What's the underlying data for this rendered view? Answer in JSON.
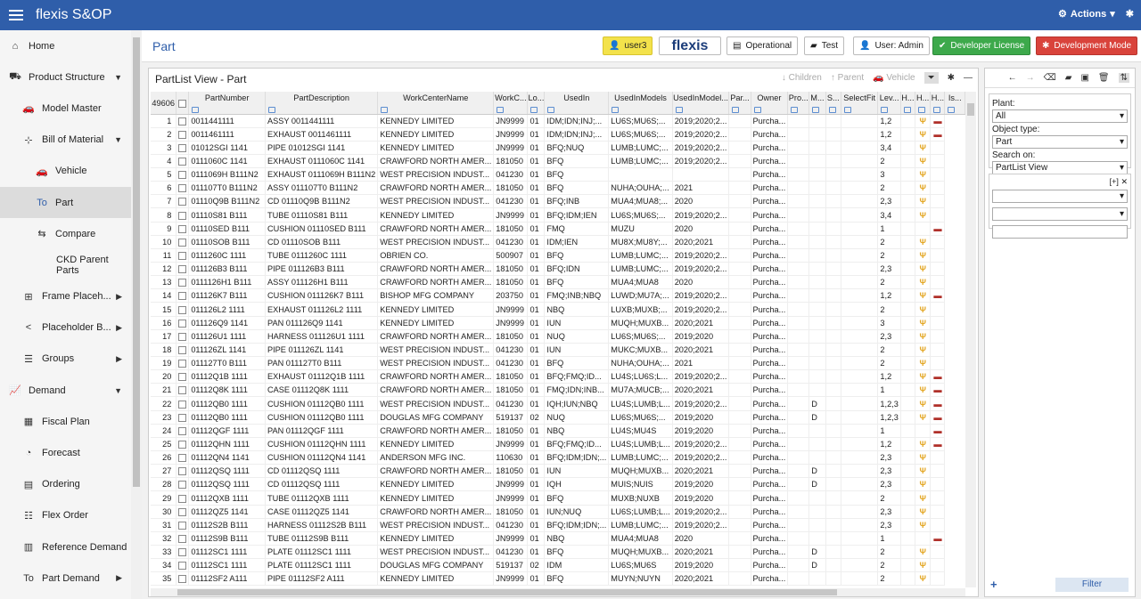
{
  "app": {
    "title": "flexis S&OP",
    "actions_label": "Actions"
  },
  "sidebar": {
    "items": [
      {
        "label": "Home",
        "icon": "home-icon",
        "level": 0,
        "glyph": "⌂"
      },
      {
        "label": "Product Structure",
        "icon": "truck-icon",
        "level": 0,
        "glyph": "⛟",
        "arrow": "▼"
      },
      {
        "label": "Model Master",
        "icon": "car-icon",
        "level": 1,
        "glyph": "🚗"
      },
      {
        "label": "Bill of Material",
        "icon": "tree-icon",
        "level": 1,
        "glyph": "⊹",
        "arrow": "▼"
      },
      {
        "label": "Vehicle",
        "icon": "car-icon",
        "level": 2,
        "glyph": "🚗"
      },
      {
        "label": "Part",
        "icon": "part-icon",
        "level": 2,
        "glyph": "To",
        "active": true
      },
      {
        "label": "Compare",
        "icon": "compare-icon",
        "level": 2,
        "glyph": "⇆"
      },
      {
        "label": "CKD Parent Parts",
        "icon": "",
        "level": 3,
        "glyph": ""
      },
      {
        "label": "Frame Placeh...",
        "icon": "frame-icon",
        "level": 1,
        "glyph": "⊞",
        "arrow": "▶"
      },
      {
        "label": "Placeholder B...",
        "icon": "share-icon",
        "level": 1,
        "glyph": "<",
        "arrow": "▶"
      },
      {
        "label": "Groups",
        "icon": "stack-icon",
        "level": 1,
        "glyph": "☰",
        "arrow": "▶"
      },
      {
        "label": "Demand",
        "icon": "chart-icon",
        "level": 0,
        "glyph": "📈",
        "arrow": "▼"
      },
      {
        "label": "Fiscal Plan",
        "icon": "calendar-icon",
        "level": 1,
        "glyph": "▦"
      },
      {
        "label": "Forecast",
        "icon": "forecast-icon",
        "level": 1,
        "glyph": "◔"
      },
      {
        "label": "Ordering",
        "icon": "clipboard-icon",
        "level": 1,
        "glyph": "▤"
      },
      {
        "label": "Flex Order",
        "icon": "list-icon",
        "level": 1,
        "glyph": "☷"
      },
      {
        "label": "Reference Demand",
        "icon": "document-icon",
        "level": 1,
        "glyph": "▥"
      },
      {
        "label": "Part Demand",
        "icon": "part-icon",
        "level": 1,
        "glyph": "To",
        "arrow": "▶"
      }
    ]
  },
  "header": {
    "page_title": "Part",
    "user_chip": "user3",
    "logo": "flexis",
    "env": "Operational",
    "folder": "Test",
    "user_admin": "User: Admin",
    "license": "Developer License",
    "mode": "Development Mode"
  },
  "panel": {
    "title": "PartList View - Part",
    "tools": {
      "children": "Children",
      "parent": "Parent",
      "vehicle": "Vehicle"
    }
  },
  "grid": {
    "count": "49606",
    "columns": [
      "PartNumber",
      "PartDescription",
      "WorkCenterName",
      "WorkC...",
      "Lo...",
      "UsedIn",
      "UsedInModels",
      "UsedInModel...",
      "Par...",
      "Owner",
      "Pro...",
      "M...",
      "S...",
      "SelectFit",
      "Lev...",
      "H...",
      "H...",
      "H...",
      "Is..."
    ],
    "rows": [
      [
        "1",
        "0011441111",
        "ASSY 0011441111",
        "KENNEDY LIMITED",
        "JN9999",
        "01",
        "IDM;IDN;INJ;...",
        "LU6S;MU6S;...",
        "2019;2020;2...",
        "",
        "Purcha...",
        "",
        "",
        "",
        "",
        "1,2",
        "",
        "T",
        "C"
      ],
      [
        "2",
        "0011461111",
        "EXHAUST 0011461111",
        "KENNEDY LIMITED",
        "JN9999",
        "01",
        "IDM;IDN;INJ;...",
        "LU6S;MU6S;...",
        "2019;2020;2...",
        "",
        "Purcha...",
        "",
        "",
        "",
        "",
        "1,2",
        "",
        "T",
        "C"
      ],
      [
        "3",
        "01012SGI 1141",
        "PIPE 01012SGI 1141",
        "KENNEDY LIMITED",
        "JN9999",
        "01",
        "BFQ;NUQ",
        "LUMB;LUMC;...",
        "2019;2020;2...",
        "",
        "Purcha...",
        "",
        "",
        "",
        "",
        "3,4",
        "",
        "T",
        ""
      ],
      [
        "4",
        "0111060C 1141",
        "EXHAUST 0111060C 1141",
        "CRAWFORD NORTH AMER...",
        "181050",
        "01",
        "BFQ",
        "LUMB;LUMC;...",
        "2019;2020;2...",
        "",
        "Purcha...",
        "",
        "",
        "",
        "",
        "2",
        "",
        "T",
        ""
      ],
      [
        "5",
        "0111069H B111N2",
        "EXHAUST 0111069H B111N2",
        "WEST PRECISION INDUST...",
        "041230",
        "01",
        "BFQ",
        "",
        "",
        "",
        "Purcha...",
        "",
        "",
        "",
        "",
        "3",
        "",
        "T",
        ""
      ],
      [
        "6",
        "011107T0 B111N2",
        "ASSY 011107T0 B111N2",
        "CRAWFORD NORTH AMER...",
        "181050",
        "01",
        "BFQ",
        "NUHA;OUHA;...",
        "2021",
        "",
        "Purcha...",
        "",
        "",
        "",
        "",
        "2",
        "",
        "T",
        ""
      ],
      [
        "7",
        "01110Q9B B111N2",
        "CD 01110Q9B B111N2",
        "WEST PRECISION INDUST...",
        "041230",
        "01",
        "BFQ;INB",
        "MUA4;MUA8;...",
        "2020",
        "",
        "Purcha...",
        "",
        "",
        "",
        "",
        "2,3",
        "",
        "T",
        ""
      ],
      [
        "8",
        "01110S81 B111",
        "TUBE 01110S81 B111",
        "KENNEDY LIMITED",
        "JN9999",
        "01",
        "BFQ;IDM;IEN",
        "LU6S;MU6S;...",
        "2019;2020;2...",
        "",
        "Purcha...",
        "",
        "",
        "",
        "",
        "3,4",
        "",
        "T",
        ""
      ],
      [
        "9",
        "01110SED B111",
        "CUSHION 01110SED B111",
        "CRAWFORD NORTH AMER...",
        "181050",
        "01",
        "FMQ",
        "MUZU",
        "2020",
        "",
        "Purcha...",
        "",
        "",
        "",
        "",
        "1",
        "",
        "",
        "C"
      ],
      [
        "10",
        "01110SOB B111",
        "CD 01110SOB B111",
        "WEST PRECISION INDUST...",
        "041230",
        "01",
        "IDM;IEN",
        "MU8X;MU8Y;...",
        "2020;2021",
        "",
        "Purcha...",
        "",
        "",
        "",
        "",
        "2",
        "",
        "T",
        ""
      ],
      [
        "11",
        "0111260C 1111",
        "TUBE 0111260C 1111",
        "OBRIEN CO.",
        "500907",
        "01",
        "BFQ",
        "LUMB;LUMC;...",
        "2019;2020;2...",
        "",
        "Purcha...",
        "",
        "",
        "",
        "",
        "2",
        "",
        "T",
        ""
      ],
      [
        "12",
        "011126B3 B111",
        "PIPE 011126B3 B111",
        "CRAWFORD NORTH AMER...",
        "181050",
        "01",
        "BFQ;IDN",
        "LUMB;LUMC;...",
        "2019;2020;2...",
        "",
        "Purcha...",
        "",
        "",
        "",
        "",
        "2,3",
        "",
        "T",
        ""
      ],
      [
        "13",
        "0111126H1 B111",
        "ASSY 011126H1 B111",
        "CRAWFORD NORTH AMER...",
        "181050",
        "01",
        "BFQ",
        "MUA4;MUA8",
        "2020",
        "",
        "Purcha...",
        "",
        "",
        "",
        "",
        "2",
        "",
        "T",
        ""
      ],
      [
        "14",
        "011126K7 B111",
        "CUSHION 011126K7 B111",
        "BISHOP MFG COMPANY",
        "203750",
        "01",
        "FMQ;INB;NBQ",
        "LUWD;MU7A;...",
        "2019;2020;2...",
        "",
        "Purcha...",
        "",
        "",
        "",
        "",
        "1,2",
        "",
        "T",
        "C"
      ],
      [
        "15",
        "011126L2 1111",
        "EXHAUST 011126L2 1111",
        "KENNEDY LIMITED",
        "JN9999",
        "01",
        "NBQ",
        "LUXB;MUXB;...",
        "2019;2020;2...",
        "",
        "Purcha...",
        "",
        "",
        "",
        "",
        "2",
        "",
        "T",
        ""
      ],
      [
        "16",
        "011126Q9 1141",
        "PAN 011126Q9 1141",
        "KENNEDY LIMITED",
        "JN9999",
        "01",
        "IUN",
        "MUQH;MUXB...",
        "2020;2021",
        "",
        "Purcha...",
        "",
        "",
        "",
        "",
        "3",
        "",
        "T",
        ""
      ],
      [
        "17",
        "011126U1 1111",
        "HARNESS 011126U1 1111",
        "CRAWFORD NORTH AMER...",
        "181050",
        "01",
        "NUQ",
        "LU6S;MU6S;...",
        "2019;2020",
        "",
        "Purcha...",
        "",
        "",
        "",
        "",
        "2,3",
        "",
        "T",
        ""
      ],
      [
        "18",
        "011126ZL 1141",
        "PIPE 011126ZL 1141",
        "WEST PRECISION INDUST...",
        "041230",
        "01",
        "IUN",
        "MUKC;MUXB...",
        "2020;2021",
        "",
        "Purcha...",
        "",
        "",
        "",
        "",
        "2",
        "",
        "T",
        ""
      ],
      [
        "19",
        "011127T0 B111",
        "PAN 011127T0 B111",
        "WEST PRECISION INDUST...",
        "041230",
        "01",
        "BFQ",
        "NUHA;OUHA;...",
        "2021",
        "",
        "Purcha...",
        "",
        "",
        "",
        "",
        "2",
        "",
        "T",
        ""
      ],
      [
        "20",
        "01112Q1B 1111",
        "EXHAUST 01112Q1B 1111",
        "CRAWFORD NORTH AMER...",
        "181050",
        "01",
        "BFQ;FMQ;ID...",
        "LU4S;LU6S;L...",
        "2019;2020;2...",
        "",
        "Purcha...",
        "",
        "",
        "",
        "",
        "1,2",
        "",
        "T",
        "C"
      ],
      [
        "21",
        "01112Q8K 1111",
        "CASE 01112Q8K 1111",
        "CRAWFORD NORTH AMER...",
        "181050",
        "01",
        "FMQ;IDN;INB...",
        "MU7A;MUCB;...",
        "2020;2021",
        "",
        "Purcha...",
        "",
        "",
        "",
        "",
        "1",
        "",
        "T",
        "C"
      ],
      [
        "22",
        "01112QB0 1111",
        "CUSHION 01112QB0 1111",
        "WEST PRECISION INDUST...",
        "041230",
        "01",
        "IQH;IUN;NBQ",
        "LU4S;LUMB;L...",
        "2019;2020;2...",
        "",
        "Purcha...",
        "",
        "D",
        "",
        "",
        "1,2,3",
        "",
        "T",
        "C"
      ],
      [
        "23",
        "01112QB0 1111",
        "CUSHION 01112QB0 1111",
        "DOUGLAS MFG COMPANY",
        "519137",
        "02",
        "NUQ",
        "LU6S;MU6S;...",
        "2019;2020",
        "",
        "Purcha...",
        "",
        "D",
        "",
        "",
        "1,2,3",
        "",
        "T",
        "C"
      ],
      [
        "24",
        "01112QGF 1111",
        "PAN 01112QGF 1111",
        "CRAWFORD NORTH AMER...",
        "181050",
        "01",
        "NBQ",
        "LU4S;MU4S",
        "2019;2020",
        "",
        "Purcha...",
        "",
        "",
        "",
        "",
        "1",
        "",
        "",
        "C"
      ],
      [
        "25",
        "01112QHN 1111",
        "CUSHION 01112QHN 1111",
        "KENNEDY LIMITED",
        "JN9999",
        "01",
        "BFQ;FMQ;ID...",
        "LU4S;LUMB;L...",
        "2019;2020;2...",
        "",
        "Purcha...",
        "",
        "",
        "",
        "",
        "1,2",
        "",
        "T",
        "C"
      ],
      [
        "26",
        "01112QN4 1141",
        "CUSHION 01112QN4 1141",
        "ANDERSON MFG INC.",
        "110630",
        "01",
        "BFQ;IDM;IDN;...",
        "LUMB;LUMC;...",
        "2019;2020;2...",
        "",
        "Purcha...",
        "",
        "",
        "",
        "",
        "2,3",
        "",
        "T",
        ""
      ],
      [
        "27",
        "01112QSQ 1111",
        "CD 01112QSQ 1111",
        "CRAWFORD NORTH AMER...",
        "181050",
        "01",
        "IUN",
        "MUQH;MUXB...",
        "2020;2021",
        "",
        "Purcha...",
        "",
        "D",
        "",
        "",
        "2,3",
        "",
        "T",
        ""
      ],
      [
        "28",
        "01112QSQ 1111",
        "CD 01112QSQ 1111",
        "KENNEDY LIMITED",
        "JN9999",
        "01",
        "IQH",
        "MUIS;NUIS",
        "2019;2020",
        "",
        "Purcha...",
        "",
        "D",
        "",
        "",
        "2,3",
        "",
        "T",
        ""
      ],
      [
        "29",
        "01112QXB 1111",
        "TUBE 01112QXB 1111",
        "KENNEDY LIMITED",
        "JN9999",
        "01",
        "BFQ",
        "MUXB;NUXB",
        "2019;2020",
        "",
        "Purcha...",
        "",
        "",
        "",
        "",
        "2",
        "",
        "T",
        ""
      ],
      [
        "30",
        "01112QZ5 1141",
        "CASE 01112QZ5 1141",
        "CRAWFORD NORTH AMER...",
        "181050",
        "01",
        "IUN;NUQ",
        "LU6S;LUMB;L...",
        "2019;2020;2...",
        "",
        "Purcha...",
        "",
        "",
        "",
        "",
        "2,3",
        "",
        "T",
        ""
      ],
      [
        "31",
        "01112S2B B111",
        "HARNESS 01112S2B B111",
        "WEST PRECISION INDUST...",
        "041230",
        "01",
        "BFQ;IDM;IDN;...",
        "LUMB;LUMC;...",
        "2019;2020;2...",
        "",
        "Purcha...",
        "",
        "",
        "",
        "",
        "2,3",
        "",
        "T",
        ""
      ],
      [
        "32",
        "01112S9B B111",
        "TUBE 01112S9B B111",
        "KENNEDY LIMITED",
        "JN9999",
        "01",
        "NBQ",
        "MUA4;MUA8",
        "2020",
        "",
        "Purcha...",
        "",
        "",
        "",
        "",
        "1",
        "",
        "",
        "C"
      ],
      [
        "33",
        "01112SC1 1111",
        "PLATE 01112SC1 1111",
        "WEST PRECISION INDUST...",
        "041230",
        "01",
        "BFQ",
        "MUQH;MUXB...",
        "2020;2021",
        "",
        "Purcha...",
        "",
        "D",
        "",
        "",
        "2",
        "",
        "T",
        ""
      ],
      [
        "34",
        "01112SC1 1111",
        "PLATE 01112SC1 1111",
        "DOUGLAS MFG COMPANY",
        "519137",
        "02",
        "IDM",
        "LU6S;MU6S",
        "2019;2020",
        "",
        "Purcha...",
        "",
        "D",
        "",
        "",
        "2",
        "",
        "T",
        ""
      ],
      [
        "35",
        "01112SF2 A111",
        "PIPE 01112SF2 A111",
        "KENNEDY LIMITED",
        "JN9999",
        "01",
        "BFQ",
        "MUYN;NUYN",
        "2020;2021",
        "",
        "Purcha...",
        "",
        "",
        "",
        "",
        "2",
        "",
        "T",
        ""
      ]
    ]
  },
  "filter": {
    "plant_label": "Plant:",
    "plant_value": "All",
    "object_label": "Object type:",
    "object_value": "Part",
    "search_label": "Search on:",
    "search_value": "PartList View",
    "box_tools": "[+]",
    "button": "Filter",
    "plus": "+"
  },
  "colors": {
    "topbar": "#2f5eaa",
    "user_chip": "#f3e24b",
    "license": "#3da94b",
    "mode": "#d9433b",
    "tree_icon": "#e3a520",
    "car_icon": "#b0302a"
  }
}
